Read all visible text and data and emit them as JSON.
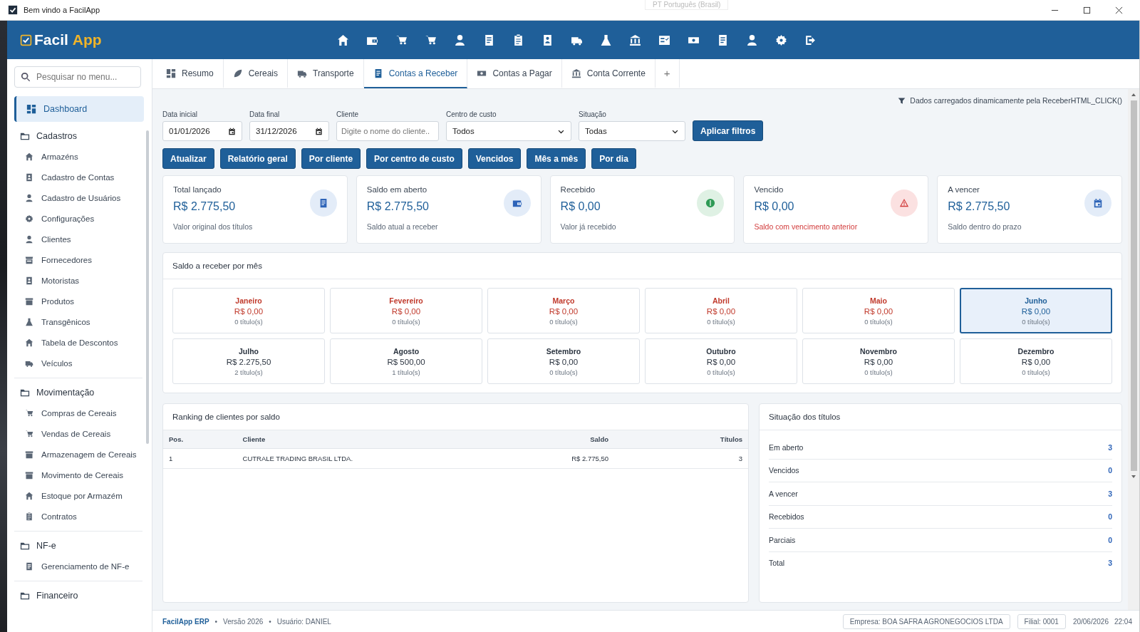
{
  "window": {
    "title": "Bem vindo a FacilApp",
    "language": "PT Português (Brasil)"
  },
  "app": {
    "logo_main": "Facil",
    "logo_accent": "App"
  },
  "sidebar": {
    "search": {
      "placeholder": "Pesquisar no menu..."
    },
    "dashboard": {
      "label": "Dashboard",
      "selected": true
    },
    "groups": [
      {
        "label": "Cadastros",
        "items": [
          {
            "label": "Armazéns",
            "selected": false
          },
          {
            "label": "Cadastro de Contas",
            "selected": false
          },
          {
            "label": "Cadastro de Usuários",
            "selected": false
          },
          {
            "label": "Configurações",
            "selected": false
          },
          {
            "label": "Clientes",
            "selected": false
          },
          {
            "label": "Fornecedores",
            "selected": false
          },
          {
            "label": "Motoristas",
            "selected": false
          },
          {
            "label": "Produtos",
            "selected": false
          },
          {
            "label": "Transgênicos",
            "selected": false
          },
          {
            "label": "Tabela de Descontos",
            "selected": false
          },
          {
            "label": "Veículos",
            "selected": false
          }
        ]
      },
      {
        "label": "Movimentação",
        "items": [
          {
            "label": "Compras de Cereais",
            "selected": false
          },
          {
            "label": "Vendas de Cereais",
            "selected": false
          },
          {
            "label": "Armazenagem de Cereais",
            "selected": false
          },
          {
            "label": "Movimento de Cereais",
            "selected": false
          },
          {
            "label": "Estoque por Armazém",
            "selected": false
          },
          {
            "label": "Contratos",
            "selected": false
          }
        ]
      },
      {
        "label": "NF-e",
        "items": [
          {
            "label": "Gerenciamento de NF-e",
            "selected": false
          }
        ]
      },
      {
        "label": "Financeiro"
      }
    ]
  },
  "tabs": [
    {
      "label": "Resumo",
      "selected": false
    },
    {
      "label": "Cereais",
      "selected": false
    },
    {
      "label": "Transporte",
      "selected": false
    },
    {
      "label": "Contas a Receber",
      "selected": true
    },
    {
      "label": "Contas a Pagar",
      "selected": false
    },
    {
      "label": "Conta Corrente",
      "selected": false
    }
  ],
  "new_tab": "+",
  "notice": "Dados carregados dinamicamente pela ReceberHTML_CLICK()",
  "filters": [
    {
      "label": "Data inicial",
      "kind": "date",
      "value": "01/01/2026"
    },
    {
      "label": "Data final",
      "kind": "date",
      "value": "31/12/2026"
    },
    {
      "label": "Cliente",
      "kind": "text",
      "placeholder": "Digite o nome do cliente.."
    },
    {
      "label": "Centro de custo",
      "kind": "select",
      "value": "Todos"
    },
    {
      "label": "Situação",
      "kind": "select",
      "value": "Todas"
    }
  ],
  "apply_button": "Aplicar filtros",
  "actions": [
    "Atualizar",
    "Relatório geral",
    "Por cliente",
    "Por centro de custo",
    "Vencidos",
    "Mês a mês",
    "Por dia"
  ],
  "cards": [
    {
      "title": "Total lançado",
      "value": "R$ 2.775,50",
      "note": "Valor original dos títulos",
      "kind": "info"
    },
    {
      "title": "Saldo em aberto",
      "value": "R$ 2.775,50",
      "note": "Saldo atual a receber",
      "kind": "info"
    },
    {
      "title": "Recebido",
      "value": "R$ 0,00",
      "note": "Valor já recebido",
      "kind": "success"
    },
    {
      "title": "Vencido",
      "value": "R$ 0,00",
      "note": "Saldo com vencimento anterior",
      "kind": "danger"
    },
    {
      "title": "A vencer",
      "value": "R$ 2.775,50",
      "note": "Saldo dentro do prazo",
      "kind": "info"
    }
  ],
  "months": {
    "title": "Saldo a receber por mês",
    "items": [
      {
        "month": "Janeiro",
        "value": "R$ 0,00",
        "count": "0 título(s)",
        "past": true,
        "selected": false
      },
      {
        "month": "Fevereiro",
        "value": "R$ 0,00",
        "count": "0 título(s)",
        "past": true,
        "selected": false
      },
      {
        "month": "Março",
        "value": "R$ 0,00",
        "count": "0 título(s)",
        "past": true,
        "selected": false
      },
      {
        "month": "Abril",
        "value": "R$ 0,00",
        "count": "0 título(s)",
        "past": true,
        "selected": false
      },
      {
        "month": "Maio",
        "value": "R$ 0,00",
        "count": "0 título(s)",
        "past": true,
        "selected": false
      },
      {
        "month": "Junho",
        "value": "R$ 0,00",
        "count": "0 título(s)",
        "past": false,
        "selected": true
      },
      {
        "month": "Julho",
        "value": "R$ 2.275,50",
        "count": "2 título(s)",
        "past": false,
        "selected": false
      },
      {
        "month": "Agosto",
        "value": "R$ 500,00",
        "count": "1 título(s)",
        "past": false,
        "selected": false
      },
      {
        "month": "Setembro",
        "value": "R$ 0,00",
        "count": "0 título(s)",
        "past": false,
        "selected": false
      },
      {
        "month": "Outubro",
        "value": "R$ 0,00",
        "count": "0 título(s)",
        "past": false,
        "selected": false
      },
      {
        "month": "Novembro",
        "value": "R$ 0,00",
        "count": "0 título(s)",
        "past": false,
        "selected": false
      },
      {
        "month": "Dezembro",
        "value": "R$ 0,00",
        "count": "0 título(s)",
        "past": false,
        "selected": false
      }
    ]
  },
  "ranking": {
    "title": "Ranking de clientes por saldo",
    "columns": [
      "Pos.",
      "Cliente",
      "Saldo",
      "Títulos"
    ],
    "rows": [
      [
        "1",
        "CUTRALE TRADING BRASIL LTDA.",
        "R$ 2.775,50",
        "3"
      ]
    ]
  },
  "situation": {
    "title": "Situação dos títulos",
    "rows": [
      {
        "label": "Em aberto",
        "value": "3"
      },
      {
        "label": "Vencidos",
        "value": "0"
      },
      {
        "label": "A vencer",
        "value": "3"
      },
      {
        "label": "Recebidos",
        "value": "0"
      },
      {
        "label": "Parciais",
        "value": "0"
      },
      {
        "label": "Total",
        "value": "3"
      }
    ]
  },
  "status_bar": {
    "product": "FacilApp ERP",
    "separator": "•",
    "version": "Versão 2026",
    "user": "Usuário: DANIEL",
    "company": "Empresa: BOA SAFRA AGRONEGOCIOS LTDA",
    "branch": "Filial: 0001",
    "date": "20/06/2026",
    "time": "22:04"
  }
}
